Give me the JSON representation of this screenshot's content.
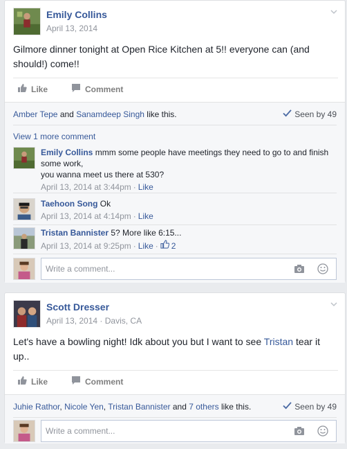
{
  "posts": [
    {
      "author": "Emily Collins",
      "date": "April 13, 2014",
      "location": "",
      "text": "Gilmore dinner tonight at Open Rice Kitchen at 5!! everyone can (and should!) come!!",
      "like_label": "Like",
      "comment_label": "Comment",
      "likers": [
        "Amber Tepe",
        "Sanamdeep Singh"
      ],
      "likes_and": "and",
      "likes_suffix": "like this.",
      "seen_label": "Seen by 49",
      "more_comments": "View 1 more comment",
      "comments": [
        {
          "author": "Emily Collins",
          "text": "mmm some people have meetings they need to go to and finish some work,",
          "text2": "you wanna meet us there at 530?",
          "time": "April 13, 2014 at 3:44pm",
          "like": "Like",
          "likes_count": ""
        },
        {
          "author": "Taehoon Song",
          "text": "Ok",
          "text2": "",
          "time": "April 13, 2014 at 4:14pm",
          "like": "Like",
          "likes_count": ""
        },
        {
          "author": "Tristan Bannister",
          "text": "5? More like 6:15...",
          "text2": "",
          "time": "April 13, 2014 at 9:25pm",
          "like": "Like",
          "likes_count": "2"
        }
      ],
      "composer_placeholder": "Write a comment..."
    },
    {
      "author": "Scott Dresser",
      "date": "April 13, 2014",
      "location": "Davis, CA",
      "text_before": "Let's have a bowling night! Idk about you but I want to see ",
      "text_mention": "Tristan",
      "text_after": " tear it up..",
      "like_label": "Like",
      "comment_label": "Comment",
      "likers": [
        "Juhie Rathor",
        "Nicole Yen",
        "Tristan Bannister"
      ],
      "likes_others": "7 others",
      "likes_and": "and",
      "likes_suffix": "like this.",
      "seen_label": "Seen by 49",
      "composer_placeholder": "Write a comment..."
    }
  ],
  "dot": "·",
  "comma": ",",
  "colors": {
    "link": "#365899",
    "meta": "#90949c",
    "ufi_bg": "#f6f7f9"
  },
  "icons": [
    "thumbs-up-icon",
    "comment-icon",
    "checkmark-icon",
    "camera-icon",
    "smiley-icon",
    "chevron-down-icon"
  ]
}
